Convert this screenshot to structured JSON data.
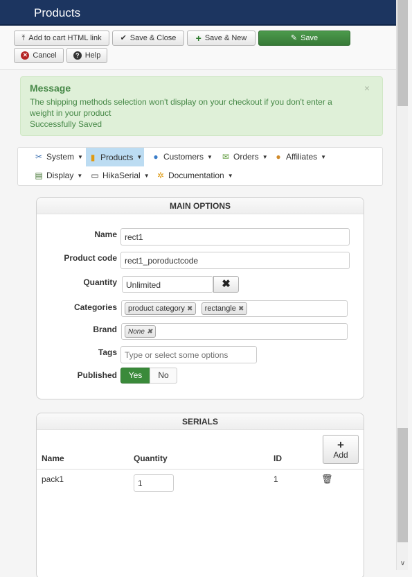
{
  "header": {
    "title": "Products"
  },
  "toolbar": {
    "add_to_cart": "Add to cart HTML link",
    "save_close": "Save & Close",
    "save_new": "Save & New",
    "save": "Save",
    "cancel": "Cancel",
    "help": "Help"
  },
  "message": {
    "heading": "Message",
    "line1": "The shipping methods selection won't display on your checkout if you don't enter a",
    "line2": "weight in your product",
    "line3": "Successfully Saved",
    "close": "×"
  },
  "menu": {
    "system": "System",
    "products": "Products",
    "customers": "Customers",
    "orders": "Orders",
    "affiliates": "Affiliates",
    "display": "Display",
    "hikaserial": "HikaSerial",
    "documentation": "Documentation"
  },
  "main_options": {
    "title": "MAIN OPTIONS",
    "name_label": "Name",
    "name_value": "rect1",
    "code_label": "Product code",
    "code_value": "rect1_poroductcode",
    "quantity_label": "Quantity",
    "quantity_value": "Unlimited",
    "categories_label": "Categories",
    "categories": [
      "product category",
      "rectangle"
    ],
    "brand_label": "Brand",
    "brand_value": "None",
    "tags_label": "Tags",
    "tags_placeholder": "Type or select some options",
    "published_label": "Published",
    "yes": "Yes",
    "no": "No"
  },
  "serials": {
    "title": "SERIALS",
    "col_name": "Name",
    "col_quantity": "Quantity",
    "col_id": "ID",
    "add": "Add",
    "rows": [
      {
        "name": "pack1",
        "quantity": "1",
        "id": "1"
      }
    ]
  }
}
